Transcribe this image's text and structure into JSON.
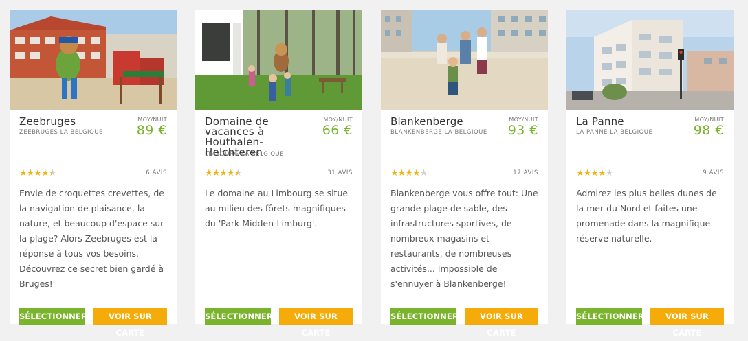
{
  "cards": [
    {
      "title": "Zeebruges",
      "subtitle": "ZEEBRUGES LA BELGIQUE",
      "price_label": "MOY/NUIT",
      "price": "89 €",
      "rating": 4.5,
      "reviews": "6 AVIS",
      "description": "Envie de croquettes crevettes, de la navigation de plaisance, la nature, et beaucoup d'espace sur la plage? Alors Zeebruges est la réponse à tous vos besoins. Découvrez ce secret bien gardé à Bruges!",
      "select_label": "SÉLECTIONNER",
      "map_label": "VOIR SUR CARTE"
    },
    {
      "title": "Domaine de vacances à Houthalen-Helchteren",
      "subtitle": "LIMBOURG LA BELGIQUE",
      "price_label": "MOY/NUIT",
      "price": "66 €",
      "rating": 4.5,
      "reviews": "31 AVIS",
      "description": "Le domaine au Limbourg se situe au milieu des fôrets magnifiques du 'Park Midden-Limburg'.",
      "select_label": "SÉLECTIONNER",
      "map_label": "VOIR SUR CARTE"
    },
    {
      "title": "Blankenberge",
      "subtitle": "BLANKENBERGE LA BELGIQUE",
      "price_label": "MOY/NUIT",
      "price": "93 €",
      "rating": 4,
      "reviews": "17 AVIS",
      "description": "Blankenberge vous offre tout: Une grande plage de sable, des infrastructures sportives, de nombreux magasins et restaurants, de nombreuses activités... Impossible de s'ennuyer à Blankenberge!",
      "select_label": "SÉLECTIONNER",
      "map_label": "VOIR SUR CARTE"
    },
    {
      "title": "La Panne",
      "subtitle": "LA PANNE LA BELGIQUE",
      "price_label": "MOY/NUIT",
      "price": "98 €",
      "rating": 4,
      "reviews": "9 AVIS",
      "description": "Admirez les plus belles dunes de la mer du Nord et faites une promenade dans la magnifique réserve naturelle.",
      "select_label": "SÉLECTIONNER",
      "map_label": "VOIR SUR CARTE"
    }
  ],
  "colors": {
    "price": "#7ab42d",
    "select_button": "#7ab42d",
    "map_button": "#f5ab0a",
    "star": "#f0b40c"
  }
}
